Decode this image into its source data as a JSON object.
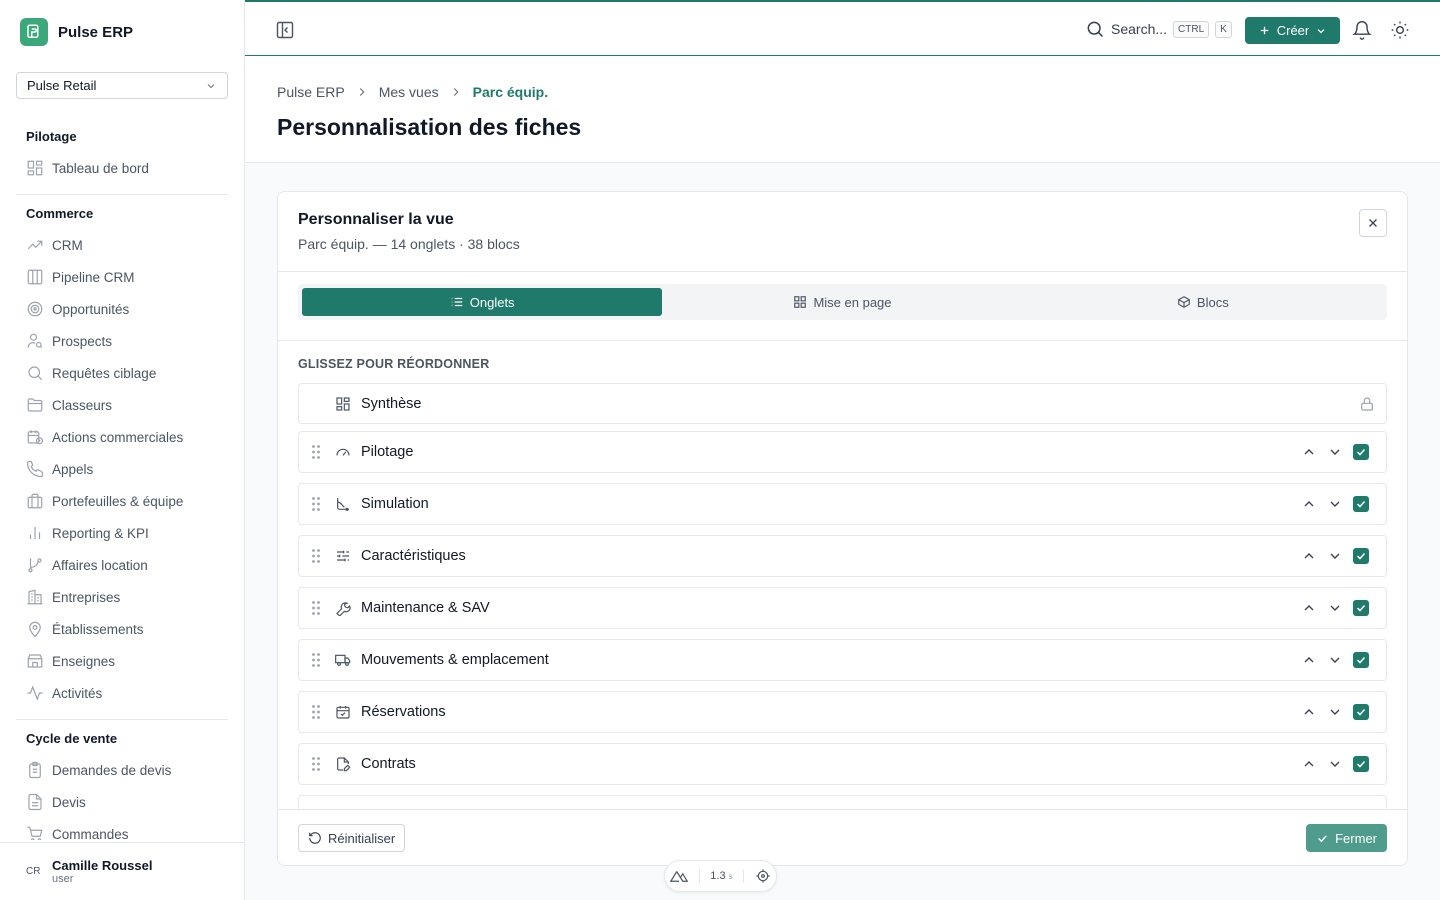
{
  "brand": {
    "name": "Pulse ERP"
  },
  "org_select": {
    "value": "Pulse Retail"
  },
  "sidebar": {
    "sections": [
      {
        "title": "Pilotage",
        "items": [
          {
            "label": "Tableau de bord",
            "icon": "dashboard-icon"
          }
        ]
      },
      {
        "title": "Commerce",
        "items": [
          {
            "label": "CRM",
            "icon": "trend-icon"
          },
          {
            "label": "Pipeline CRM",
            "icon": "kanban-icon"
          },
          {
            "label": "Opportunités",
            "icon": "target-icon"
          },
          {
            "label": "Prospects",
            "icon": "user-search-icon"
          },
          {
            "label": "Requêtes ciblage",
            "icon": "search-icon"
          },
          {
            "label": "Classeurs",
            "icon": "folder-icon"
          },
          {
            "label": "Actions commerciales",
            "icon": "calendar-clock-icon"
          },
          {
            "label": "Appels",
            "icon": "phone-icon"
          },
          {
            "label": "Portefeuilles & équipe",
            "icon": "briefcase-icon"
          },
          {
            "label": "Reporting & KPI",
            "icon": "bar-chart-icon"
          },
          {
            "label": "Affaires location",
            "icon": "git-branch-icon"
          },
          {
            "label": "Entreprises",
            "icon": "building-icon"
          },
          {
            "label": "Établissements",
            "icon": "map-pin-icon"
          },
          {
            "label": "Enseignes",
            "icon": "store-icon"
          },
          {
            "label": "Activités",
            "icon": "activity-icon"
          }
        ]
      },
      {
        "title": "Cycle de vente",
        "items": [
          {
            "label": "Demandes de devis",
            "icon": "clipboard-icon"
          },
          {
            "label": "Devis",
            "icon": "file-text-icon"
          },
          {
            "label": "Commandes",
            "icon": "cart-icon"
          }
        ]
      }
    ]
  },
  "user": {
    "initials": "CR",
    "name": "Camille Roussel",
    "role": "user"
  },
  "topbar": {
    "search_label": "Search...",
    "kbd_ctrl": "CTRL",
    "kbd_k": "K",
    "create_label": "Créer"
  },
  "breadcrumb": {
    "items": [
      "Pulse ERP",
      "Mes vues"
    ],
    "current": "Parc équip."
  },
  "page_title": "Personnalisation des fiches",
  "panel": {
    "title": "Personnaliser la vue",
    "subtitle": "Parc équip. — 14 onglets · 38 blocs",
    "tabs": [
      {
        "label": "Onglets",
        "active": true
      },
      {
        "label": "Mise en page",
        "active": false
      },
      {
        "label": "Blocs",
        "active": false
      }
    ],
    "list_label": "GLISSEZ POUR RÉORDONNER",
    "rows": [
      {
        "label": "Synthèse",
        "icon": "layout-grid-icon",
        "locked": true
      },
      {
        "label": "Pilotage",
        "icon": "gauge-icon",
        "checked": true
      },
      {
        "label": "Simulation",
        "icon": "axis-icon",
        "checked": true
      },
      {
        "label": "Caractéristiques",
        "icon": "sliders-icon",
        "checked": true
      },
      {
        "label": "Maintenance & SAV",
        "icon": "wrench-icon",
        "checked": true
      },
      {
        "label": "Mouvements & emplacement",
        "icon": "truck-icon",
        "checked": true
      },
      {
        "label": "Réservations",
        "icon": "calendar-check-icon",
        "checked": true
      },
      {
        "label": "Contrats",
        "icon": "file-pen-icon",
        "checked": true
      }
    ],
    "reset_label": "Réinitialiser",
    "close_label": "Fermer"
  },
  "devbar": {
    "time": "1.3",
    "unit": "s"
  },
  "colors": {
    "accent": "#1f7a6c",
    "brand": "#3aa87a"
  }
}
